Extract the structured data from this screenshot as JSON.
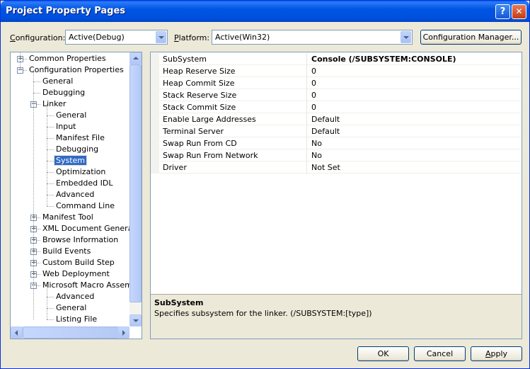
{
  "window": {
    "title": "Project Property Pages",
    "help_label": "?",
    "close_label": "✕"
  },
  "header": {
    "configuration_label_accel": "C",
    "configuration_label_rest": "onfiguration:",
    "configuration_value": "Active(Debug)",
    "platform_label_accel": "P",
    "platform_label_rest": "latform:",
    "platform_value": "Active(Win32)",
    "config_manager_label": "Configuration Manager..."
  },
  "tree": {
    "items": [
      {
        "label": "Common Properties",
        "expander": "+"
      },
      {
        "label": "Configuration Properties",
        "expander": "−"
      },
      {
        "label": "General"
      },
      {
        "label": "Debugging"
      },
      {
        "label": "Linker",
        "expander": "−"
      },
      {
        "label": "General"
      },
      {
        "label": "Input"
      },
      {
        "label": "Manifest File"
      },
      {
        "label": "Debugging"
      },
      {
        "label": "System",
        "selected": true
      },
      {
        "label": "Optimization"
      },
      {
        "label": "Embedded IDL"
      },
      {
        "label": "Advanced"
      },
      {
        "label": "Command Line"
      },
      {
        "label": "Manifest Tool",
        "expander": "+"
      },
      {
        "label": "XML Document Generator",
        "expander": "+"
      },
      {
        "label": "Browse Information",
        "expander": "+"
      },
      {
        "label": "Build Events",
        "expander": "+"
      },
      {
        "label": "Custom Build Step",
        "expander": "+"
      },
      {
        "label": "Web Deployment",
        "expander": "+"
      },
      {
        "label": "Microsoft Macro Assembler",
        "expander": "−"
      },
      {
        "label": "Advanced"
      },
      {
        "label": "General"
      },
      {
        "label": "Listing File"
      }
    ]
  },
  "properties": {
    "rows": [
      {
        "name": "SubSystem",
        "value": "Console (/SUBSYSTEM:CONSOLE)",
        "bold": true
      },
      {
        "name": "Heap Reserve Size",
        "value": "0"
      },
      {
        "name": "Heap Commit Size",
        "value": "0"
      },
      {
        "name": "Stack Reserve Size",
        "value": "0"
      },
      {
        "name": "Stack Commit Size",
        "value": "0"
      },
      {
        "name": "Enable Large Addresses",
        "value": "Default"
      },
      {
        "name": "Terminal Server",
        "value": "Default"
      },
      {
        "name": "Swap Run From CD",
        "value": "No"
      },
      {
        "name": "Swap Run From Network",
        "value": "No"
      },
      {
        "name": "Driver",
        "value": "Not Set"
      }
    ]
  },
  "description": {
    "title": "SubSystem",
    "text": "Specifies subsystem for the linker.     (/SUBSYSTEM:[type])"
  },
  "footer": {
    "ok_label": "OK",
    "cancel_label": "Cancel",
    "apply_accel": "A",
    "apply_rest": "pply"
  }
}
